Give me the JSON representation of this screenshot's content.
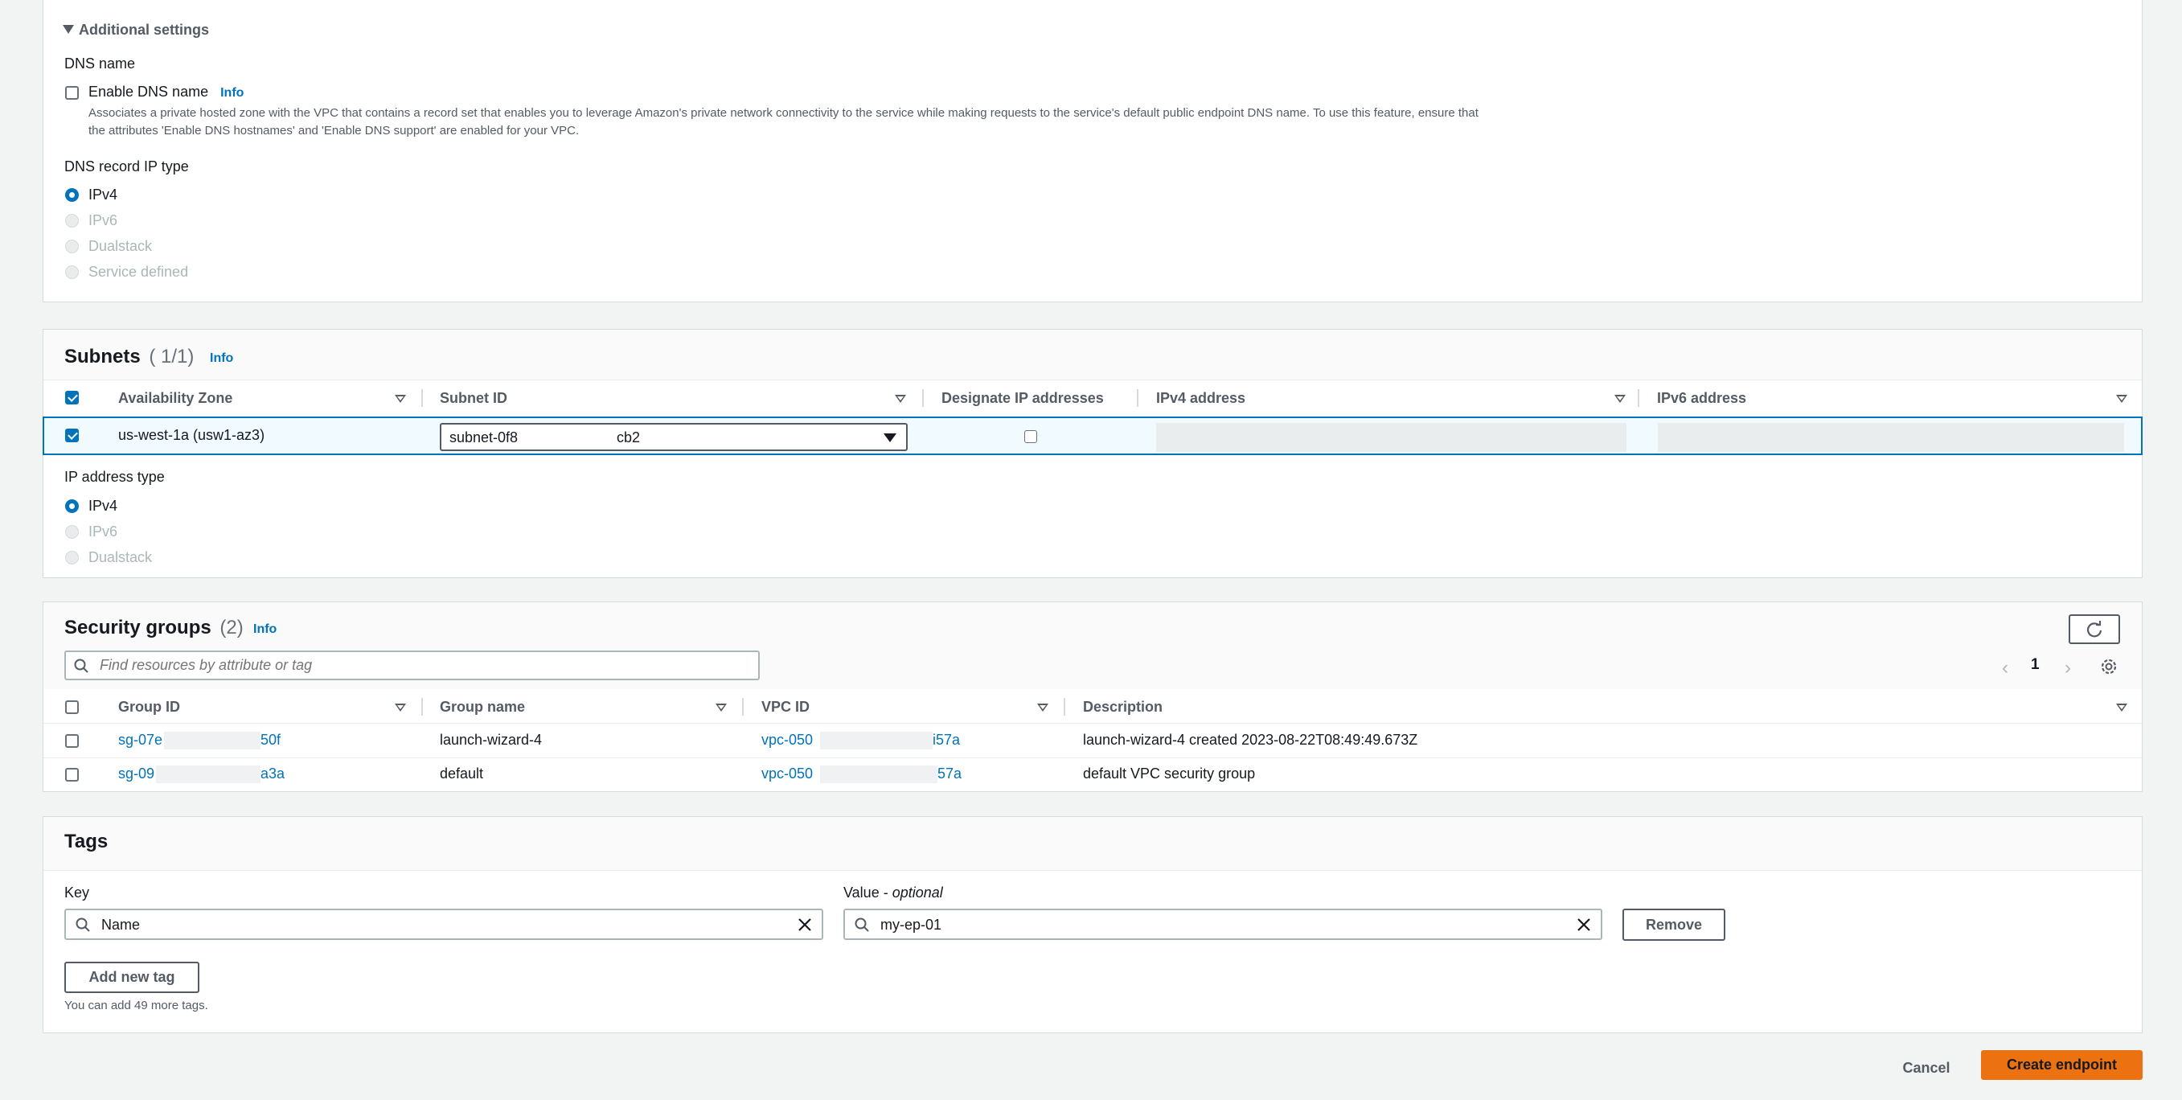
{
  "additional_settings": {
    "toggle_label": "Additional settings",
    "dns_name_label": "DNS name",
    "enable_dns_label": "Enable DNS name",
    "info": "Info",
    "description_line1": "Associates a private hosted zone with the VPC that contains a record set that enables you to leverage Amazon's private network connectivity to the service while making requests to the service's default public endpoint DNS name. To use this feature, ensure that",
    "description_line2": "the attributes 'Enable DNS hostnames' and 'Enable DNS support' are enabled for your VPC.",
    "dns_record_ip_type_label": "DNS record IP type",
    "options": [
      "IPv4",
      "IPv6",
      "Dualstack",
      "Service defined"
    ],
    "selected": "IPv4"
  },
  "subnets": {
    "title": "Subnets",
    "count": "( 1/1)",
    "info": "Info",
    "columns": [
      "Availability Zone",
      "Subnet ID",
      "Designate IP addresses",
      "IPv4 address",
      "IPv6 address"
    ],
    "row": {
      "availability_zone": "us-west-1a (usw1-az3)",
      "subnet_prefix": "subnet-0f8",
      "subnet_suffix": "cb2"
    },
    "ip_address_type_label": "IP address type",
    "ip_options": [
      "IPv4",
      "IPv6",
      "Dualstack"
    ],
    "ip_selected": "IPv4"
  },
  "security_groups": {
    "title": "Security groups",
    "count": "(2)",
    "info": "Info",
    "search_placeholder": "Find resources by attribute or tag",
    "page_number": "1",
    "columns": [
      "Group ID",
      "Group name",
      "VPC ID",
      "Description"
    ],
    "rows": [
      {
        "group_id_prefix": "sg-07e",
        "group_id_suffix": "50f",
        "group_name": "launch-wizard-4",
        "vpc_prefix": "vpc-050",
        "vpc_suffix": "i57a",
        "description": "launch-wizard-4 created 2023-08-22T08:49:49.673Z"
      },
      {
        "group_id_prefix": "sg-09",
        "group_id_suffix": "a3a",
        "group_name": "default",
        "vpc_prefix": "vpc-050",
        "vpc_suffix": "57a",
        "description": "default VPC security group"
      }
    ]
  },
  "tags": {
    "title": "Tags",
    "key_label": "Key",
    "value_label": "Value -",
    "value_optional": "optional",
    "key_value": "Name",
    "value_value": "my-ep-01",
    "remove_label": "Remove",
    "add_label": "Add new tag",
    "hint": "You can add 49 more tags."
  },
  "footer": {
    "cancel_label": "Cancel",
    "create_label": "Create endpoint"
  },
  "colors": {
    "accent": "#0073bb",
    "primary_button": "#ec7211"
  }
}
